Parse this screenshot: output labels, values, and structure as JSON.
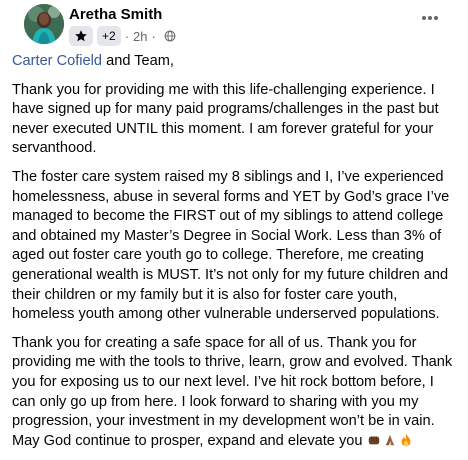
{
  "post": {
    "author": "Aretha Smith",
    "badge_count": "+2",
    "time": "2h",
    "separator": "·",
    "audience_icon": "globe-icon",
    "more_icon": "more-horizontal-icon",
    "badge_icon": "star-icon"
  },
  "content": {
    "mention": "Carter Cofield",
    "greeting_rest": " and Team,",
    "paragraph_1": "Thank you for providing me with this life-challenging experience. I have signed up for many paid programs/challenges in the past but never executed UNTIL this moment. I am forever grateful for your servanthood.",
    "paragraph_2": "The foster care system raised my 8 siblings and I, I’ve experienced homelessness, abuse in several forms and YET by God’s grace I’ve managed to become the FIRST out of my siblings to attend college and obtained my Master’s Degree in Social Work. Less than 3% of aged out foster care youth go to college. Therefore, me creating generational wealth is MUST. It’s not only for my future children and their children or my family but it is also for foster care youth, homeless youth among other vulnerable underserved populations.",
    "paragraph_3": "Thank you for creating a safe space for all of us. Thank you for providing me with the tools to thrive, learn, grow and evolved. Thank you for exposing us to our next level. I’ve hit rock bottom before, I can only go up from here. I look forward to sharing with you my progression, your investment in my development won’t be in vain. May God continue to prosper, expand and elevate you",
    "emojis": [
      "fist-bump-emoji",
      "praying-hands-emoji",
      "fire-emoji"
    ]
  },
  "colors": {
    "mention": "#385898",
    "meta_text": "#65676b",
    "badge_bg": "#e4e6eb"
  }
}
